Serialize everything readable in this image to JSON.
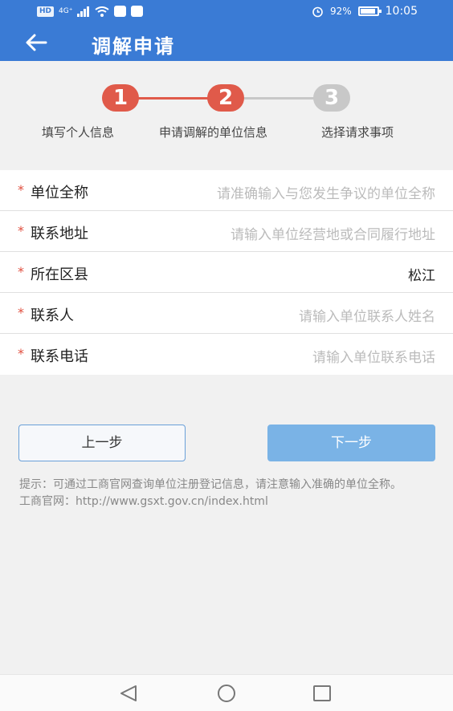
{
  "status_bar": {
    "left_badges": [
      "HD",
      "4G⁺"
    ],
    "battery": "92%",
    "time": "10:05",
    "icons": [
      "signal-icon",
      "wifi-icon",
      "app-icon",
      "app-icon",
      "alarm-icon",
      "battery-icon"
    ]
  },
  "header": {
    "title": "调解申请",
    "back_icon": "arrow-left-icon"
  },
  "steps": [
    {
      "number": "1",
      "label": "填写个人信息",
      "state": "done"
    },
    {
      "number": "2",
      "label": "申请调解的单位信息",
      "state": "active"
    },
    {
      "number": "3",
      "label": "选择请求事项",
      "state": "pending"
    }
  ],
  "form": {
    "required_mark": "*",
    "rows": [
      {
        "label": "单位全称",
        "placeholder": "请准确输入与您发生争议的单位全称",
        "value": ""
      },
      {
        "label": "联系地址",
        "placeholder": "请输入单位经营地或合同履行地址",
        "value": ""
      },
      {
        "label": "所在区县",
        "placeholder": "",
        "value": "松江"
      },
      {
        "label": "联系人",
        "placeholder": "请输入单位联系人姓名",
        "value": ""
      },
      {
        "label": "联系电话",
        "placeholder": "请输入单位联系电话",
        "value": ""
      }
    ]
  },
  "buttons": {
    "prev": "上一步",
    "next": "下一步"
  },
  "tip": {
    "line1": "提示：可通过工商官网查询单位注册登记信息，请注意输入准确的单位全称。",
    "line2": "工商官网：http://www.gsxt.gov.cn/index.html"
  },
  "colors": {
    "header": "#3a7bd5",
    "step_active": "#e05a4a",
    "step_pending": "#c8c8c8",
    "required": "#e04e3e",
    "next_button": "#7ab3e6"
  }
}
